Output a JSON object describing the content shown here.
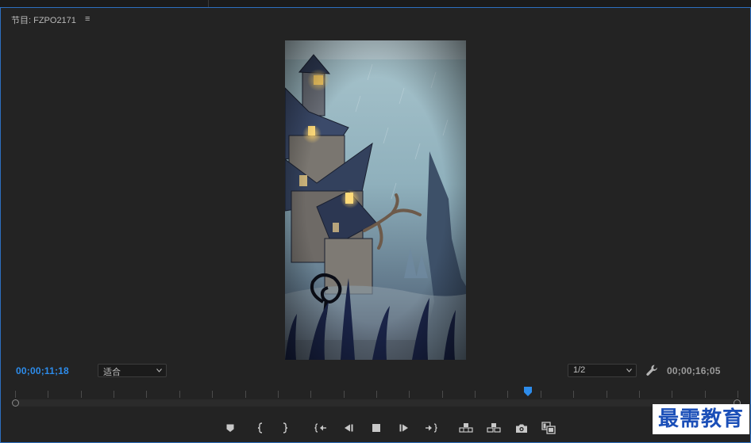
{
  "panel": {
    "title": "节目: FZPO2171",
    "menu_glyph": "≡"
  },
  "playback": {
    "current_timecode": "00;00;11;18",
    "duration_timecode": "00;00;16;05",
    "fit_zoom": "适合",
    "resolution": "1/2",
    "playhead_fraction": 0.71
  },
  "transport": {
    "buttons": [
      {
        "name": "add-marker-button",
        "icon": "marker-icon"
      },
      {
        "name": "mark-in-button",
        "icon": "mark-in-icon"
      },
      {
        "name": "mark-out-button",
        "icon": "mark-out-icon"
      },
      {
        "name": "go-to-in-button",
        "icon": "go-to-in-icon"
      },
      {
        "name": "step-back-button",
        "icon": "step-back-icon"
      },
      {
        "name": "stop-button",
        "icon": "stop-icon"
      },
      {
        "name": "step-forward-button",
        "icon": "step-forward-icon"
      },
      {
        "name": "go-to-out-button",
        "icon": "go-to-out-icon"
      },
      {
        "name": "lift-button",
        "icon": "lift-icon"
      },
      {
        "name": "extract-button",
        "icon": "extract-icon"
      },
      {
        "name": "export-frame-button",
        "icon": "camera-icon"
      },
      {
        "name": "compare-view-button",
        "icon": "compare-icon"
      }
    ]
  },
  "watermark": {
    "text": "最需教育"
  },
  "colors": {
    "accent": "#2d8ceb",
    "panel_border": "#2d6fc0",
    "panel_bg": "#232323"
  }
}
